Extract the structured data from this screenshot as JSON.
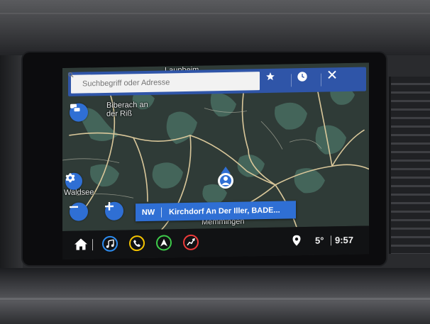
{
  "search": {
    "placeholder": "Suchbegriff oder Adresse"
  },
  "map": {
    "labels": {
      "top_town": "Laupheim",
      "biberach": "Biberach an der Riß",
      "waldsee": "Waldsee",
      "memmingen": "Memmingen"
    }
  },
  "navigation": {
    "direction": "NW",
    "destination": "Kirchdorf An Der Iller, BADE..."
  },
  "status": {
    "temperature": "5°",
    "time": "9:57"
  },
  "colors": {
    "accent_blue": "#2f6fd4",
    "search_bar": "#2f55a8",
    "music_ring": "#2d8cf0",
    "phone_ring": "#f5c400",
    "nav_ring": "#3ecb4a",
    "energy_ring": "#ee3a3a"
  },
  "icons": {
    "search": "search-icon",
    "favorites": "star-icon",
    "recent": "clock-icon",
    "close": "close-icon",
    "traffic": "traffic-icon",
    "settings": "gear-icon",
    "zoom_out": "minus-icon",
    "zoom_in": "plus-icon",
    "home": "home-icon",
    "music": "music-icon",
    "phone": "phone-icon",
    "navigation": "navigation-icon",
    "energy": "energy-icon",
    "location": "location-pin-icon"
  }
}
